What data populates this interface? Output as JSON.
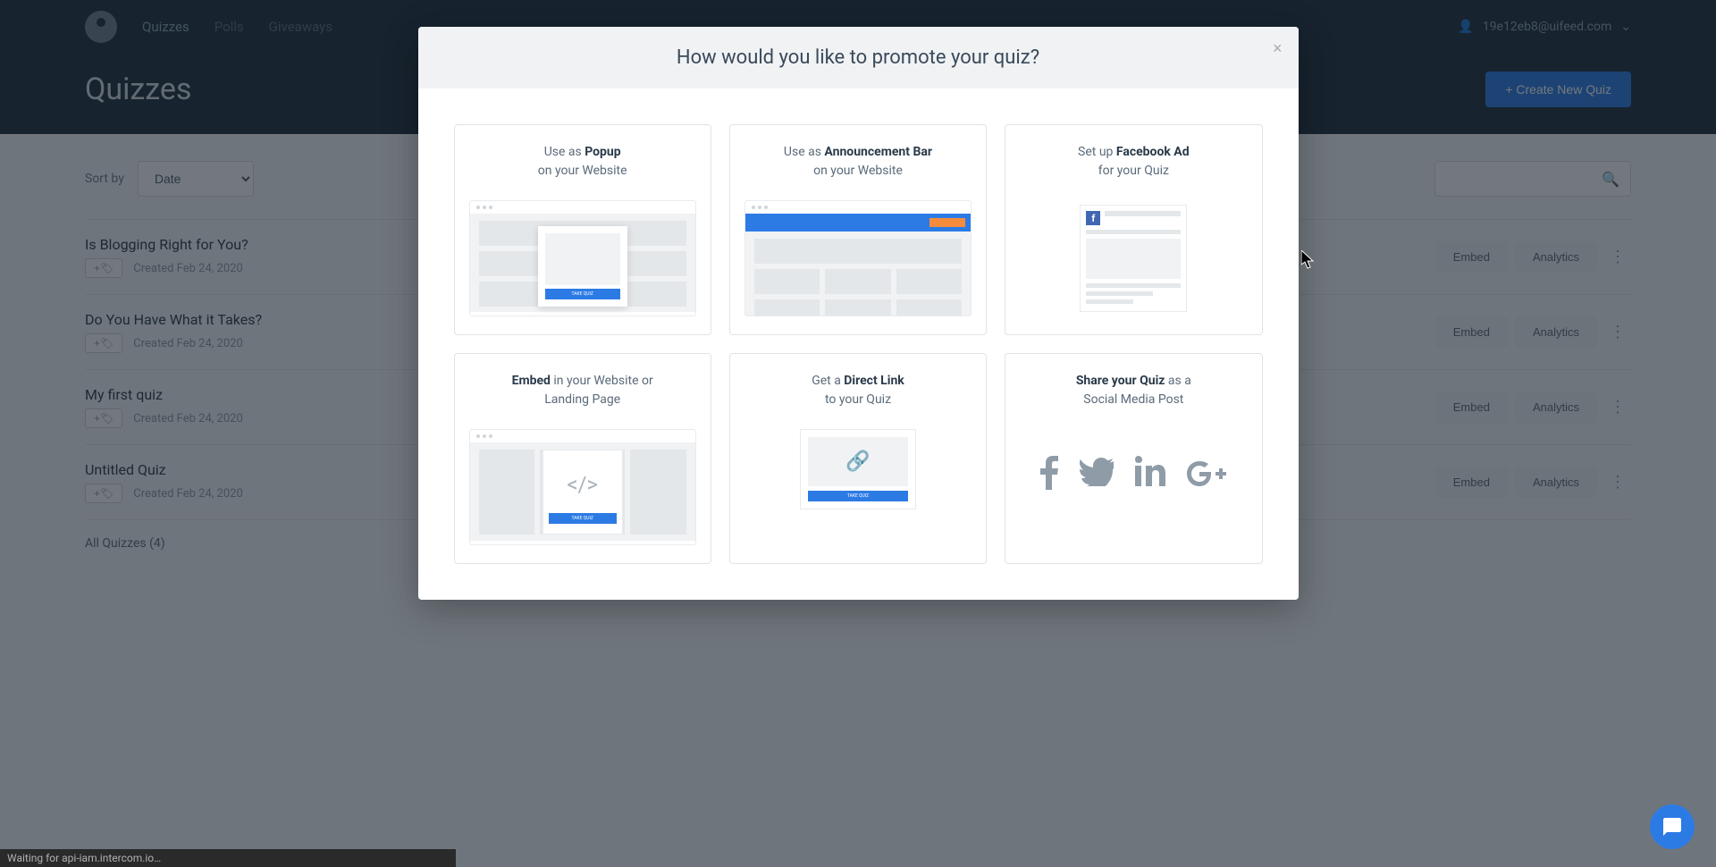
{
  "nav": {
    "links": [
      "Quizzes",
      "Polls",
      "Giveaways"
    ],
    "user_email": "19e12eb8@uifeed.com"
  },
  "page": {
    "title": "Quizzes",
    "create_btn": "+ Create New Quiz"
  },
  "toolbar": {
    "sort_label": "Sort by",
    "sort_value": "Date"
  },
  "quizzes": [
    {
      "title": "Is Blogging Right for You?",
      "created": "Created Feb 24, 2020"
    },
    {
      "title": "Do You Have What it Takes?",
      "created": "Created Feb 24, 2020"
    },
    {
      "title": "My first quiz",
      "created": "Created Feb 24, 2020"
    },
    {
      "title": "Untitled Quiz",
      "created": "Created Feb 24, 2020"
    }
  ],
  "quiz_actions": {
    "tag": "+🏷",
    "embed": "Embed",
    "analytics": "Analytics"
  },
  "count": "All Quizzes (4)",
  "modal": {
    "title": "How would you like to promote your quiz?",
    "close": "×",
    "options": {
      "popup": {
        "pre": "Use as ",
        "bold": "Popup",
        "post": "",
        "line2": "on your Website"
      },
      "anno": {
        "pre": "Use as ",
        "bold": "Announcement Bar",
        "post": "",
        "line2": "on your Website"
      },
      "fb": {
        "pre": "Set up ",
        "bold": "Facebook Ad",
        "post": "",
        "line2": "for your Quiz"
      },
      "embed": {
        "pre": "",
        "bold": "Embed",
        "post": " in your Website or",
        "line2": "Landing Page"
      },
      "link": {
        "pre": "Get a ",
        "bold": "Direct Link",
        "post": "",
        "line2": "to your Quiz"
      },
      "social": {
        "pre": "",
        "bold": "Share your Quiz",
        "post": " as a",
        "line2": "Social Media Post"
      }
    },
    "take_quiz": "TAKE QUIZ"
  },
  "status": "Waiting for api-iam.intercom.io…"
}
